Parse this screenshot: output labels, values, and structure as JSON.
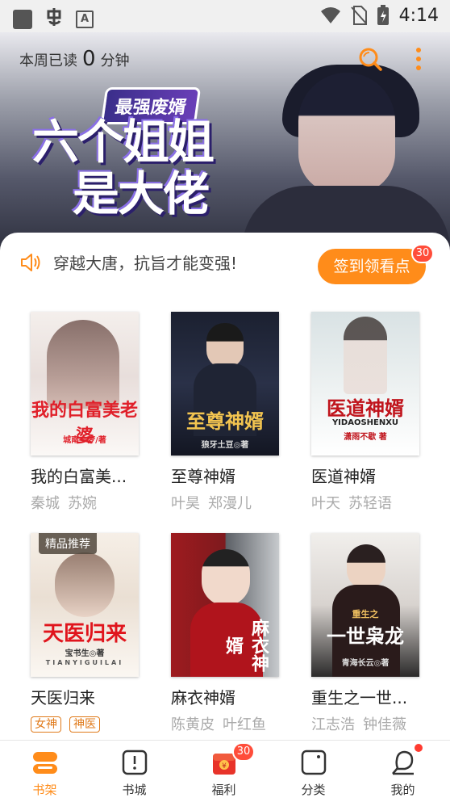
{
  "status_bar": {
    "time": "4:14"
  },
  "banner": {
    "weekly_read_prefix": "本周已读",
    "weekly_read_value": "0",
    "weekly_read_unit": "分钟",
    "tag_title": "最强废婿",
    "main_title_line1": "六个姐姐",
    "main_title_line2": "是大佬"
  },
  "notice": {
    "text": "穿越大唐，抗旨才能变强!"
  },
  "checkin": {
    "label": "签到领看点",
    "badge": "30"
  },
  "books": [
    {
      "title": "我的白富美...",
      "authors": [
        "秦城",
        "苏婉"
      ],
      "cover_title": "我的白富美老婆",
      "cover_author": "城南一梦/著"
    },
    {
      "title": "至尊神婿",
      "authors": [
        "叶昊",
        "郑漫儿"
      ],
      "cover_title": "至尊神婿",
      "cover_author": "狼牙土豆◎著"
    },
    {
      "title": "医道神婿",
      "authors": [
        "叶天",
        "苏轻语"
      ],
      "cover_title": "医道神婿",
      "cover_sub": "YIDAOSHENXU",
      "cover_author": "潇雨不歇 著"
    },
    {
      "title": "天医归来",
      "tags": [
        "女神",
        "神医"
      ],
      "cover_title": "天医归来",
      "cover_author": "宝书生◎著",
      "cover_sub": "TIANYIGUILAI",
      "ribbon": "精品推荐"
    },
    {
      "title": "麻衣神婿",
      "authors": [
        "陈黄皮",
        "叶红鱼"
      ],
      "cover_title": "麻衣神婿"
    },
    {
      "title": "重生之一世...",
      "authors": [
        "江志浩",
        "钟佳薇"
      ],
      "cover_title": "一世枭龙",
      "cover_sub": "重生之",
      "cover_author": "青海长云◎著"
    }
  ],
  "tabs": [
    {
      "label": "书架",
      "icon": "bookshelf-icon",
      "active": true
    },
    {
      "label": "书城",
      "icon": "bookstore-icon"
    },
    {
      "label": "福利",
      "icon": "gift-icon",
      "badge": "30"
    },
    {
      "label": "分类",
      "icon": "category-icon"
    },
    {
      "label": "我的",
      "icon": "profile-icon"
    }
  ],
  "colors": {
    "accent": "#ff8c1a",
    "badge": "#ff4d3a"
  }
}
